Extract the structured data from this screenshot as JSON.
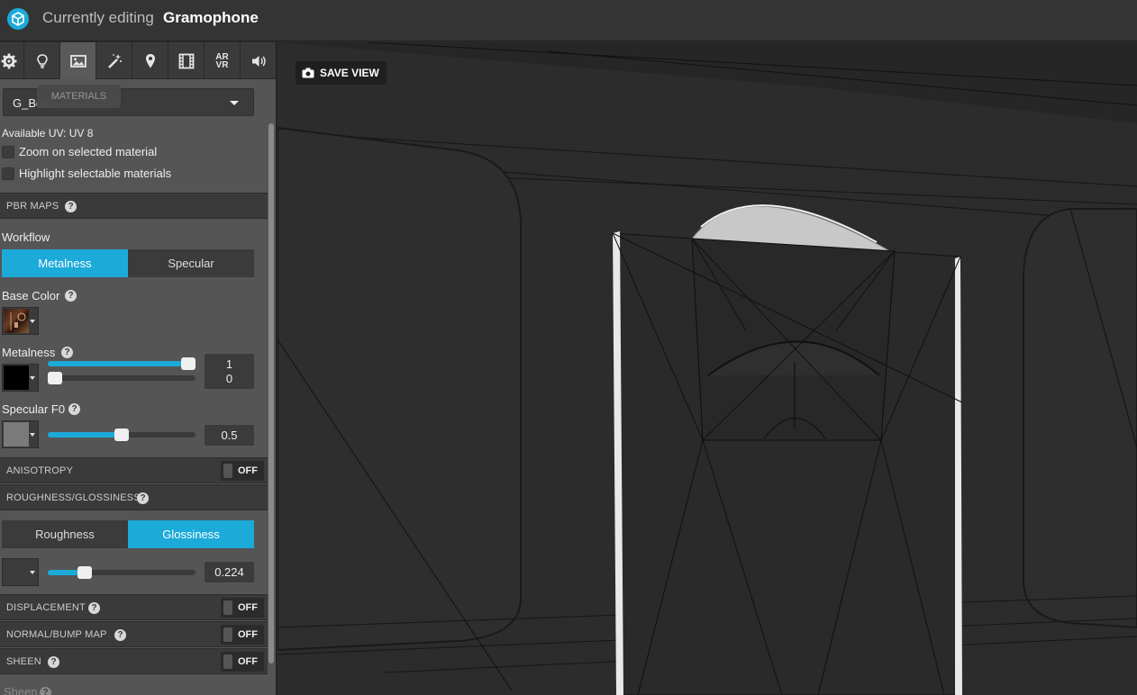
{
  "header": {
    "title_prefix": "Currently editing",
    "model_name": "Gramophone"
  },
  "tabs": [
    {
      "name": "settings",
      "icon": "gear-icon"
    },
    {
      "name": "lighting",
      "icon": "lightbulb-icon"
    },
    {
      "name": "materials",
      "icon": "image-icon",
      "active": true
    },
    {
      "name": "post-processing",
      "icon": "magic-wand-icon"
    },
    {
      "name": "annotations",
      "icon": "map-pin-icon"
    },
    {
      "name": "animation",
      "icon": "film-icon"
    },
    {
      "name": "ar-vr",
      "label": "AR\nVR"
    },
    {
      "name": "sound",
      "icon": "speaker-icon"
    }
  ],
  "tooltip": "MATERIALS",
  "material_select": {
    "value": "G_Box"
  },
  "available_uv": "Available UV: UV 8",
  "options": {
    "zoom_label": "Zoom on selected material",
    "highlight_label": "Highlight selectable materials"
  },
  "pbr": {
    "section_label": "PBR MAPS",
    "workflow_label": "Workflow",
    "workflow_options": [
      "Metalness",
      "Specular"
    ],
    "workflow_selected": "Metalness",
    "base_color": {
      "label": "Base Color",
      "value": "1",
      "level": 1.0,
      "swatch": "texture"
    },
    "metalness": {
      "label": "Metalness",
      "value": "0",
      "level": 0.0,
      "swatch": "#000000"
    },
    "specular_f0": {
      "label": "Specular F0",
      "value": "0.5",
      "level": 0.5,
      "swatch": "#7a7a7a"
    }
  },
  "anisotropy": {
    "label": "ANISOTROPY",
    "state": "OFF"
  },
  "roughness": {
    "section_label": "ROUGHNESS/GLOSSINESS",
    "options": [
      "Roughness",
      "Glossiness"
    ],
    "selected": "Glossiness",
    "value": "0.224",
    "level": 0.224,
    "swatch": "#3c3c3c"
  },
  "displacement": {
    "label": "DISPLACEMENT",
    "state": "OFF"
  },
  "normal_bump": {
    "label": "NORMAL/BUMP MAP",
    "state": "OFF"
  },
  "sheen": {
    "label": "SHEEN",
    "state": "OFF"
  },
  "sheen_sub": "Sheen",
  "viewport": {
    "save_view_label": "SAVE VIEW"
  },
  "colors": {
    "accent": "#1caad9",
    "panel": "#555555",
    "section": "#3a3a3a"
  }
}
